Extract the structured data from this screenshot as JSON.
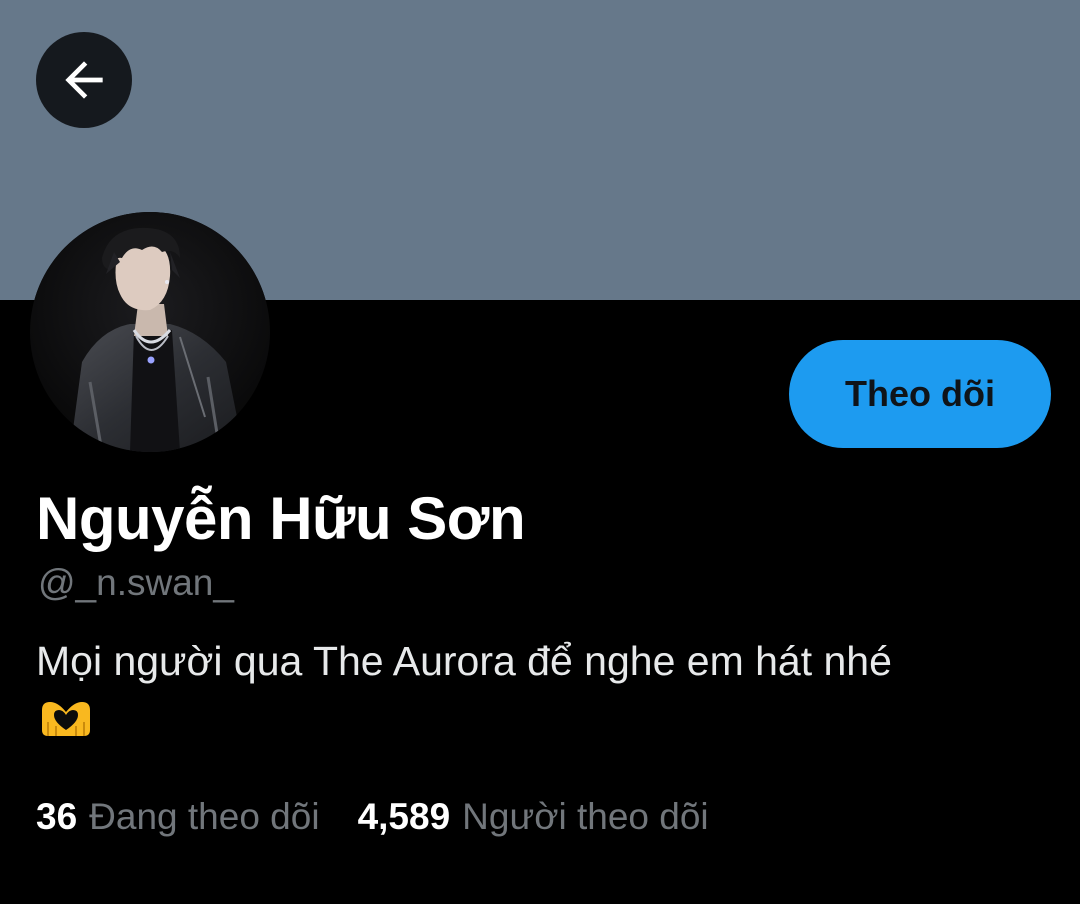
{
  "header": {
    "banner_color": "#66788a",
    "back_icon": "arrow-left-icon"
  },
  "profile": {
    "avatar_icon": "profile-photo",
    "display_name": "Nguyễn Hữu Sơn",
    "handle": "@_n.swan_",
    "bio": "Mọi người qua The Aurora để nghe em hát nhé",
    "bio_emoji": "heart-hands-emoji"
  },
  "actions": {
    "follow_label": "Theo dõi",
    "follow_color": "#1d9bf0"
  },
  "stats": {
    "following_count": "36",
    "following_label": "Đang theo dõi",
    "followers_count": "4,589",
    "followers_label": "Người theo dõi"
  }
}
